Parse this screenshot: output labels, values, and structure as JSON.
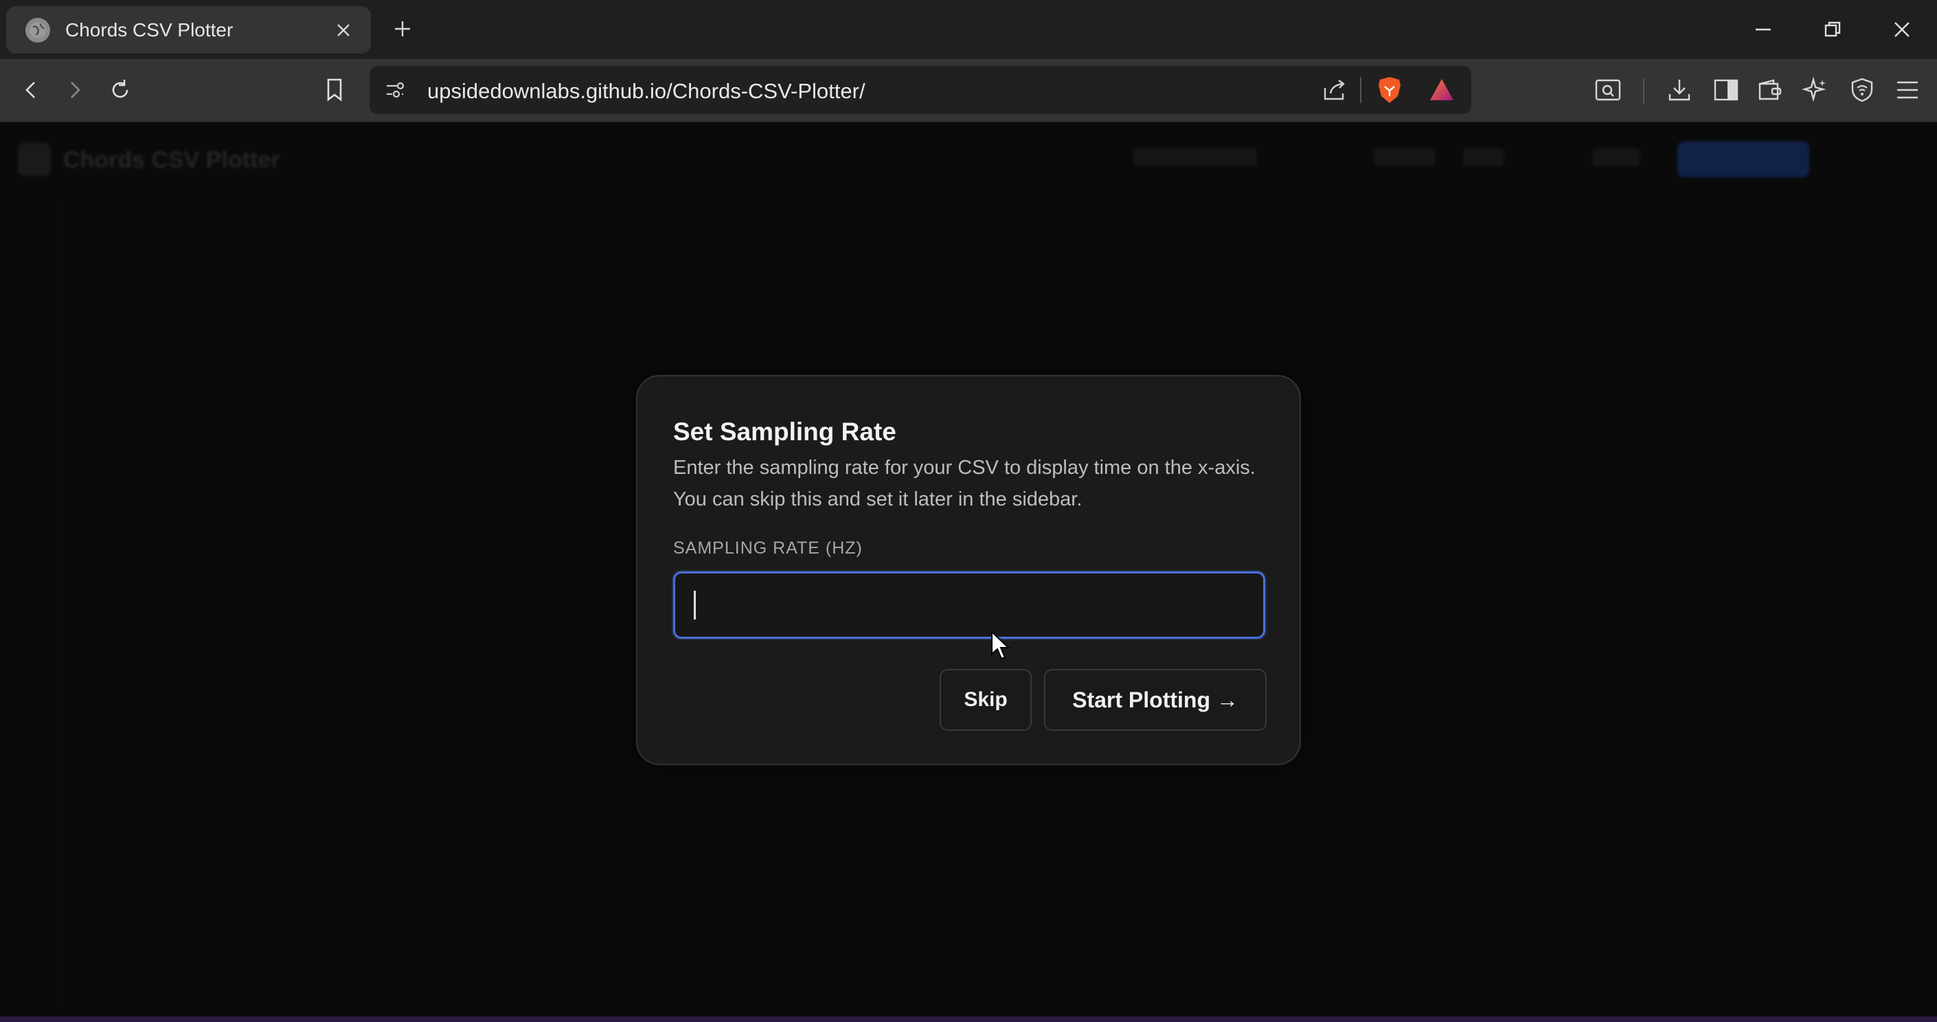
{
  "browser": {
    "tab_title": "Chords CSV Plotter",
    "url": "upsidedownlabs.github.io/Chords-CSV-Plotter/"
  },
  "app": {
    "name": "Chords CSV Plotter"
  },
  "modal": {
    "title": "Set Sampling Rate",
    "description": "Enter the sampling rate for your CSV to display time on the x-axis. You can skip this and set it later in the sidebar.",
    "field_label": "SAMPLING RATE (HZ)",
    "input_value": "",
    "skip_label": "Skip",
    "start_label": "Start Plotting →"
  },
  "colors": {
    "accent": "#4a6fd8",
    "brave_orange": "#f05a24",
    "rewards_red": "#e0245e"
  }
}
